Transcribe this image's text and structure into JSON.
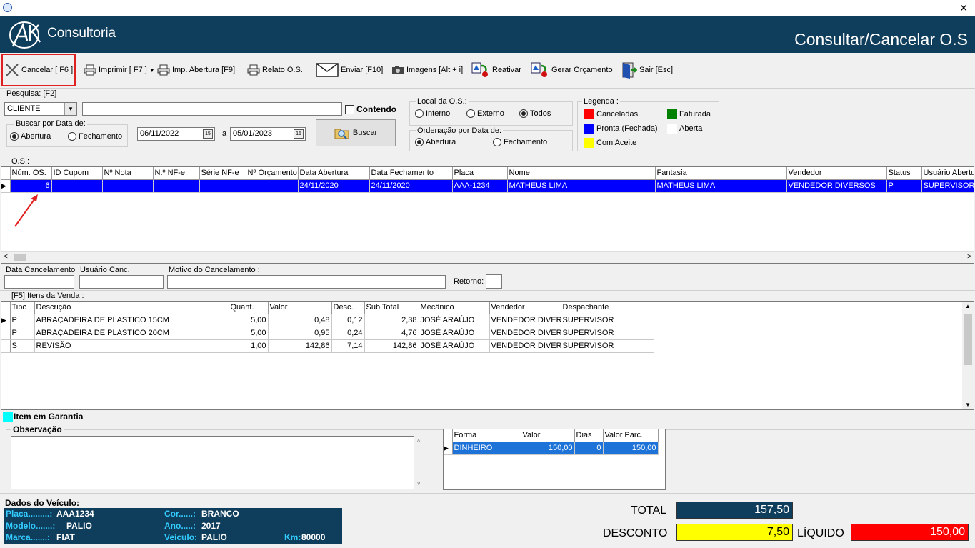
{
  "window": {
    "close_glyph": "✕"
  },
  "header": {
    "brand": "Consultoria",
    "logo_text": "AK",
    "title": "Consultar/Cancelar O.S"
  },
  "toolbar": {
    "cancelar": "Cancelar [ F6 ]",
    "imprimir": "Imprimir  [ F7 ]",
    "imp_abertura": "Imp. Abertura  [F9]",
    "relato": "Relato O.S.",
    "enviar": "Enviar [F10]",
    "imagens": "Imagens [Alt + i]",
    "reativar": "Reativar",
    "gerar_orcamento": "Gerar Orçamento",
    "sair": "Sair  [Esc]"
  },
  "search": {
    "label": "Pesquisa: [F2]",
    "type_value": "CLIENTE",
    "text_value": "",
    "contendo_label": "Contendo",
    "buscar_data_label": "Buscar por Data de:",
    "abertura_label": "Abertura",
    "fechamento_label": "Fechamento",
    "date_from": "06/11/2022",
    "date_sep": "a",
    "date_to": "05/01/2023",
    "buscar_button": "Buscar"
  },
  "local_os": {
    "label": "Local da O.S.:",
    "interno": "Interno",
    "externo": "Externo",
    "todos": "Todos"
  },
  "ordenacao": {
    "label": "Ordenação por Data de:",
    "abertura": "Abertura",
    "fechamento": "Fechamento"
  },
  "legenda": {
    "label": "Legenda :",
    "items": [
      {
        "label": "Canceladas",
        "color": "#ff0000"
      },
      {
        "label": "Faturada",
        "color": "#008000"
      },
      {
        "label": "Pronta (Fechada)",
        "color": "#0000ff"
      },
      {
        "label": "Aberta",
        "color": "#ffffff"
      },
      {
        "label": "Com Aceite",
        "color": "#ffff00"
      }
    ]
  },
  "os_grid": {
    "label": "O.S.:",
    "columns": [
      "Núm. OS.",
      "ID Cupom",
      "Nº Nota",
      "N.º NF-e",
      "Série NF-e",
      "Nº Orçamento",
      "Data Abertura",
      "Data Fechamento",
      "Placa",
      "Nome",
      "Fantasia",
      "Vendedor",
      "Status",
      "Usuário Abertu"
    ],
    "rows": [
      [
        "6",
        "",
        "",
        "",
        "",
        "",
        "24/11/2020",
        "24/11/2020",
        "AAA-1234",
        "MATHEUS LIMA",
        "MATHEUS LIMA",
        "VENDEDOR DIVERSOS",
        "P",
        "SUPERVISOR"
      ]
    ]
  },
  "cancel": {
    "data_label": "Data Cancelamento",
    "usuario_label": "Usuário Canc.",
    "motivo_label": "Motivo do Cancelamento  :",
    "retorno_label": "Retorno:"
  },
  "itens": {
    "label": "[F5]  Itens da Venda  :",
    "columns": [
      "Tipo",
      "Descrição",
      "Quant.",
      "Valor",
      "Desc.",
      "Sub Total",
      "Mecânico",
      "Vendedor",
      "Despachante"
    ],
    "rows": [
      [
        "P",
        "ABRAÇADEIRA DE PLASTICO 15CM",
        "5,00",
        "0,48",
        "0,12",
        "2,38",
        "JOSÉ ARAÚJO",
        "VENDEDOR DIVER",
        "SUPERVISOR"
      ],
      [
        "P",
        "ABRAÇADEIRA DE PLASTICO 20CM",
        "5,00",
        "0,95",
        "0,24",
        "4,76",
        "JOSÉ ARAÚJO",
        "VENDEDOR DIVER",
        "SUPERVISOR"
      ],
      [
        "S",
        "REVISÃO",
        "1,00",
        "142,86",
        "7,14",
        "142,86",
        "JOSÉ ARAÚJO",
        "VENDEDOR DIVER",
        "SUPERVISOR"
      ]
    ]
  },
  "garantia": {
    "label": "Item em Garantia",
    "color": "#00ffff"
  },
  "observacao": {
    "label": "Observação",
    "value": ""
  },
  "pagamento": {
    "columns": [
      "Forma",
      "Valor",
      "Dias",
      "Valor Parc."
    ],
    "rows": [
      [
        "DINHEIRO",
        "150,00",
        "0",
        "150,00"
      ]
    ]
  },
  "veiculo": {
    "label": "Dados do Veículo:",
    "placa_k": "Placa.........:",
    "placa_v": "AAA1234",
    "cor_k": "Cor......:",
    "cor_v": "BRANCO",
    "modelo_k": "Modelo.......:",
    "modelo_v": "PALIO",
    "ano_k": "Ano.....:",
    "ano_v": "2017",
    "marca_k": "Marca.......:",
    "marca_v": "FIAT",
    "veiculo_k": "Veículo:",
    "veiculo_v": "PALIO",
    "km_k": "Km:",
    "km_v": "80000"
  },
  "totais": {
    "total_label": "TOTAL",
    "total": "157,50",
    "desconto_label": "DESCONTO",
    "desconto": "7,50",
    "liquido_label": "LÍQUIDO",
    "liquido": "150,00"
  }
}
